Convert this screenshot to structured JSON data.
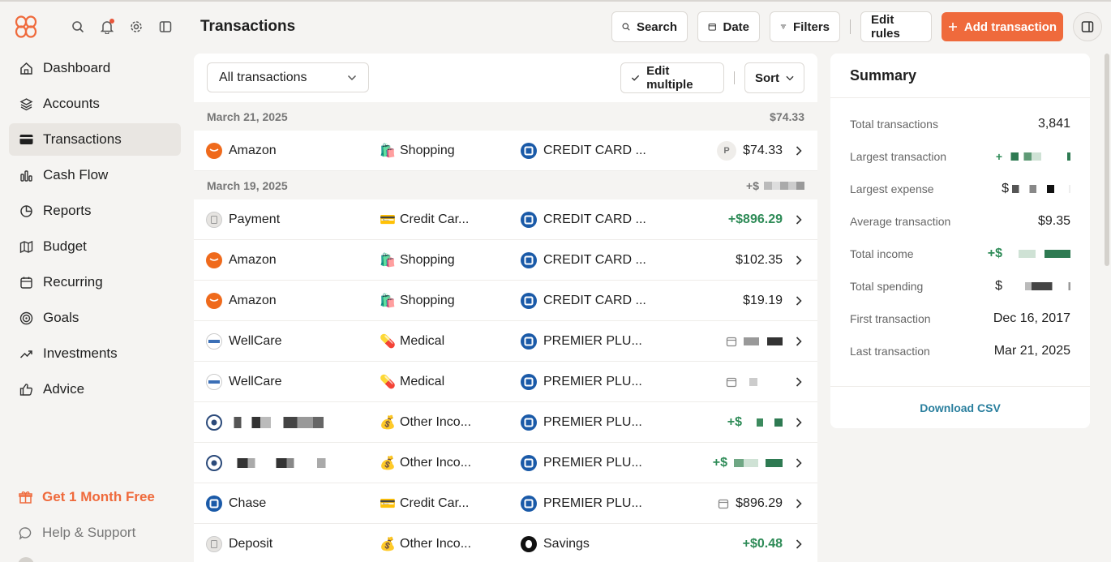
{
  "sidebar": {
    "items": [
      {
        "label": "Dashboard",
        "icon": "home-icon"
      },
      {
        "label": "Accounts",
        "icon": "layers-icon"
      },
      {
        "label": "Transactions",
        "icon": "card-icon",
        "active": true
      },
      {
        "label": "Cash Flow",
        "icon": "bar-chart-icon"
      },
      {
        "label": "Reports",
        "icon": "pie-chart-icon"
      },
      {
        "label": "Budget",
        "icon": "map-icon"
      },
      {
        "label": "Recurring",
        "icon": "calendar-icon"
      },
      {
        "label": "Goals",
        "icon": "target-icon"
      },
      {
        "label": "Investments",
        "icon": "trend-icon"
      },
      {
        "label": "Advice",
        "icon": "thumbs-up-icon"
      }
    ],
    "promo": "Get 1 Month Free",
    "help": "Help & Support"
  },
  "header": {
    "title": "Transactions",
    "search": "Search",
    "date": "Date",
    "filters": "Filters",
    "edit_rules": "Edit rules",
    "add_transaction": "Add transaction"
  },
  "list": {
    "filter_select": "All transactions",
    "edit_multiple": "Edit multiple",
    "sort": "Sort",
    "groups": [
      {
        "date": "March 21, 2025",
        "total": "$74.33"
      },
      {
        "date": "March 19, 2025",
        "total": "+$"
      }
    ],
    "rows": [
      {
        "merchant": "Amazon",
        "category_emoji": "🛍️",
        "category": "Shopping",
        "account": "CREDIT CARD ...",
        "amount": "$74.33",
        "badge": "P"
      },
      {
        "merchant": "Payment",
        "category_emoji": "💳",
        "category": "Credit Car...",
        "account": "CREDIT CARD ...",
        "amount": "+$896.29"
      },
      {
        "merchant": "Amazon",
        "category_emoji": "🛍️",
        "category": "Shopping",
        "account": "CREDIT CARD ...",
        "amount": "$102.35"
      },
      {
        "merchant": "Amazon",
        "category_emoji": "🛍️",
        "category": "Shopping",
        "account": "CREDIT CARD ...",
        "amount": "$19.19"
      },
      {
        "merchant": "WellCare",
        "category_emoji": "💊",
        "category": "Medical",
        "account": "PREMIER PLU..."
      },
      {
        "merchant": "WellCare",
        "category_emoji": "💊",
        "category": "Medical",
        "account": "PREMIER PLU..."
      },
      {
        "merchant": "",
        "category_emoji": "💰",
        "category": "Other Inco...",
        "account": "PREMIER PLU...",
        "amount": "+$"
      },
      {
        "merchant": "",
        "category_emoji": "💰",
        "category": "Other Inco...",
        "account": "PREMIER PLU...",
        "amount": "+$"
      },
      {
        "merchant": "Chase",
        "category_emoji": "💳",
        "category": "Credit Car...",
        "account": "PREMIER PLU...",
        "amount": "$896.29"
      },
      {
        "merchant": "Deposit",
        "category_emoji": "💰",
        "category": "Other Inco...",
        "account": "Savings",
        "amount": "+$0.48"
      }
    ]
  },
  "summary": {
    "title": "Summary",
    "rows": [
      {
        "label": "Total transactions",
        "value": "3,841"
      },
      {
        "label": "Largest transaction",
        "value": "+"
      },
      {
        "label": "Largest expense",
        "value": "$"
      },
      {
        "label": "Average transaction",
        "value": "$9.35"
      },
      {
        "label": "Total income",
        "value": "+$"
      },
      {
        "label": "Total spending",
        "value": "$"
      },
      {
        "label": "First transaction",
        "value": "Dec 16, 2017"
      },
      {
        "label": "Last transaction",
        "value": "Mar 21, 2025"
      }
    ],
    "download": "Download CSV"
  },
  "colors": {
    "accent": "#ef6a3c",
    "positive": "#2e8b57",
    "link": "#2a7f9e"
  }
}
